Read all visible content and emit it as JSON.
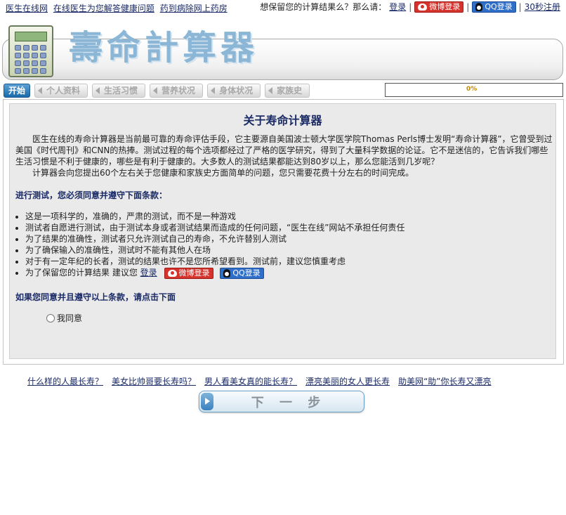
{
  "top_links": [
    "医生在线网",
    "在线医生为您解答健康问题",
    "药到病除网上药房"
  ],
  "top_right": {
    "prompt": "想保留您的计算结果么？那么请：",
    "login": "登录",
    "weibo": "微博登录",
    "qq": "QQ登录",
    "register": "30秒注册",
    "sep": "|"
  },
  "header": {
    "title": "壽命計算器"
  },
  "tabs": [
    {
      "label": "开始",
      "active": true
    },
    {
      "label": "个人资料",
      "active": false
    },
    {
      "label": "生活习惯",
      "active": false
    },
    {
      "label": "营养状况",
      "active": false
    },
    {
      "label": "身体状况",
      "active": false
    },
    {
      "label": "家族史",
      "active": false
    }
  ],
  "progress": {
    "label": "0%"
  },
  "main": {
    "title": "关于寿命计算器",
    "para1": "医生在线的寿命计算器是当前最可靠的寿命评估手段，它主要源自美国波士顿大学医学院Thomas Perls博士发明“寿命计算器”，它曾受到过美国《时代周刊》和CNN的热捧。测试过程的每个选项都经过了严格的医学研究，得到了大量科学数据的论证。它不是迷信的，它告诉我们哪些生活习惯是不利于健康的，哪些是有利于健康的。大多数人的测试结果都能达到80岁以上，那么您能活到几岁呢？",
    "para2": "计算器会向您提出60个左右关于您健康和家族史方面简单的问题，您只需要花费十分左右的时间完成。",
    "terms_heading": "进行测试，您必须同意并遵守下面条款：",
    "terms": [
      "这是一项科学的，准确的，严肃的测试，而不是一种游戏",
      "测试者自愿进行测试，由于测试本身或者测试结果而造成的任何问题，“医生在线”网站不承担任何责任",
      "为了结果的准确性，测试者只允许测试自己的寿命，不允许替别人测试",
      "为了确保输入的准确性，测试时不能有其他人在场",
      "对于有一定年纪的长者，测试的结果也许不是您所希望看到。测试前，建议您慎重考虑"
    ],
    "save_term": "为了保留您的计算结果  建议您",
    "save_login": "登录",
    "agree_heading": "如果您同意并且遵守以上条款，请点击下面",
    "agree_label": "我同意"
  },
  "bottom_links": [
    "什么样的人最长寿？",
    "美女比帅哥要长寿吗？",
    "男人看美女真的能长寿？",
    "漂亮美丽的女人更长寿",
    "助美网“助”你长寿又漂亮"
  ],
  "next_button": "下 一 步"
}
